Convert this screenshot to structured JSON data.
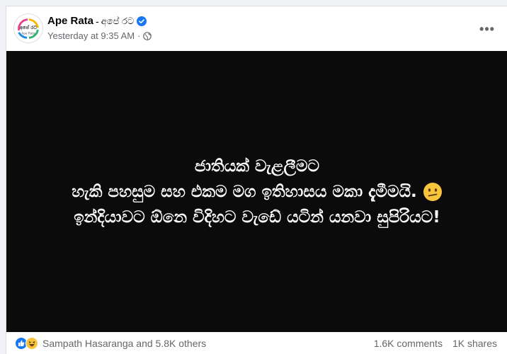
{
  "post": {
    "page_name": "Ape Rata",
    "page_name_separator": "-",
    "page_name_sinhala": "අපේ රට",
    "timestamp": "Yesterday at 9:35 AM",
    "meta_separator": "·",
    "more_label": "•••",
    "avatar_text": "අපේ රට",
    "avatar_subtext": "Ape Rata"
  },
  "image_text": {
    "line1": "ජාතියක් වැළලීමට",
    "line2": "හැකි පහසුම සහ එකම මග ඉතිහාසය මකා දැමීමයි.",
    "line3": "ඉන්දියාවට ඕනෙ විදිහට වැඩේ යටින් යනවා සුපිරියට!"
  },
  "footer": {
    "reactors": "Sampath Hasaranga and 5.8K others",
    "comments": "1.6K comments",
    "shares": "1K shares"
  },
  "icons": {
    "verified": "verified-badge-icon",
    "globe": "globe-icon",
    "like": "like-reaction-icon",
    "haha": "haha-reaction-icon",
    "confused": "confused-face-emoji"
  },
  "colors": {
    "brand_blue": "#1877f2",
    "image_bg": "#0b0b0b",
    "secondary_text": "#65676b"
  }
}
